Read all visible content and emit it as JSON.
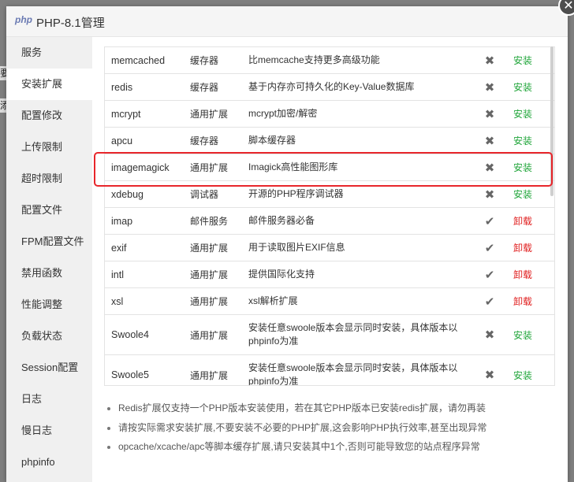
{
  "background": {
    "fragments": [
      "要",
      "添"
    ]
  },
  "dialog": {
    "logo": "php",
    "title": "PHP-8.1管理",
    "close_symbol": "✕"
  },
  "sidebar": {
    "items": [
      {
        "label": "服务",
        "active": false
      },
      {
        "label": "安装扩展",
        "active": true
      },
      {
        "label": "配置修改",
        "active": false
      },
      {
        "label": "上传限制",
        "active": false
      },
      {
        "label": "超时限制",
        "active": false
      },
      {
        "label": "配置文件",
        "active": false
      },
      {
        "label": "FPM配置文件",
        "active": false
      },
      {
        "label": "禁用函数",
        "active": false
      },
      {
        "label": "性能调整",
        "active": false
      },
      {
        "label": "负载状态",
        "active": false
      },
      {
        "label": "Session配置",
        "active": false
      },
      {
        "label": "日志",
        "active": false
      },
      {
        "label": "慢日志",
        "active": false
      },
      {
        "label": "phpinfo",
        "active": false
      }
    ]
  },
  "extensions": [
    {
      "name": "memcached",
      "type": "缓存器",
      "desc": "比memcache支持更多高级功能",
      "status": "✖",
      "action": "安装",
      "installed": false
    },
    {
      "name": "redis",
      "type": "缓存器",
      "desc": "基于内存亦可持久化的Key-Value数据库",
      "status": "✖",
      "action": "安装",
      "installed": false
    },
    {
      "name": "mcrypt",
      "type": "通用扩展",
      "desc": "mcrypt加密/解密",
      "status": "✖",
      "action": "安装",
      "installed": false
    },
    {
      "name": "apcu",
      "type": "缓存器",
      "desc": "脚本缓存器",
      "status": "✖",
      "action": "安装",
      "installed": false
    },
    {
      "name": "imagemagick",
      "type": "通用扩展",
      "desc": "Imagick高性能图形库",
      "status": "✖",
      "action": "安装",
      "installed": false
    },
    {
      "name": "xdebug",
      "type": "调试器",
      "desc": "开源的PHP程序调试器",
      "status": "✖",
      "action": "安装",
      "installed": false
    },
    {
      "name": "imap",
      "type": "邮件服务",
      "desc": "邮件服务器必备",
      "status": "✔",
      "action": "卸载",
      "installed": true
    },
    {
      "name": "exif",
      "type": "通用扩展",
      "desc": "用于读取图片EXIF信息",
      "status": "✔",
      "action": "卸载",
      "installed": true
    },
    {
      "name": "intl",
      "type": "通用扩展",
      "desc": "提供国际化支持",
      "status": "✔",
      "action": "卸载",
      "installed": true
    },
    {
      "name": "xsl",
      "type": "通用扩展",
      "desc": "xsl解析扩展",
      "status": "✔",
      "action": "卸载",
      "installed": true
    },
    {
      "name": "Swoole4",
      "type": "通用扩展",
      "desc": "安装任意swoole版本会显示同时安装，具体版本以phpinfo为准",
      "status": "✖",
      "action": "安装",
      "installed": false,
      "tall": true
    },
    {
      "name": "Swoole5",
      "type": "通用扩展",
      "desc": "安装任意swoole版本会显示同时安装，具体版本以phpinfo为准",
      "status": "✖",
      "action": "安装",
      "installed": false,
      "tall": true
    }
  ],
  "notes": [
    "Redis扩展仅支持一个PHP版本安装使用，若在其它PHP版本已安装redis扩展，请勿再装",
    "请按实际需求安装扩展,不要安装不必要的PHP扩展,这会影响PHP执行效率,甚至出现异常",
    "opcache/xcache/apc等脚本缓存扩展,请只安装其中1个,否则可能导致您的站点程序异常"
  ],
  "colors": {
    "install": "#20a53a",
    "uninstall": "#e02020",
    "highlight": "#e8262b"
  }
}
